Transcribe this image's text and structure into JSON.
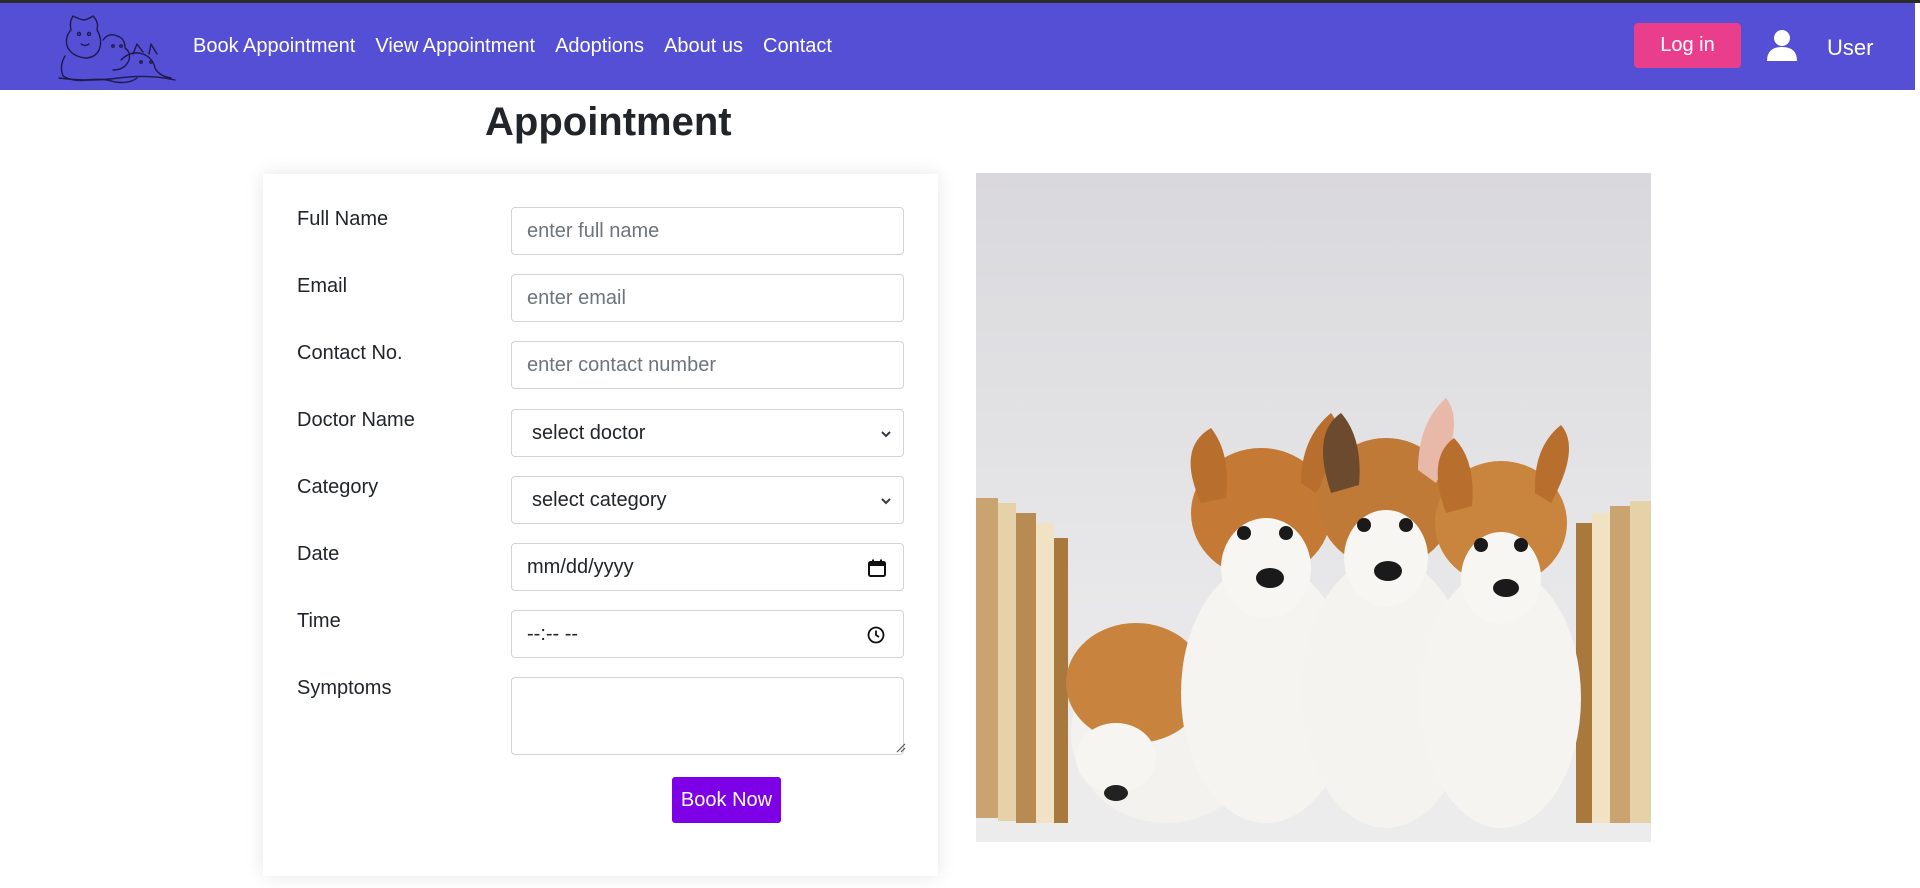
{
  "nav": {
    "links": [
      "Book Appointment",
      "View Appointment",
      "Adoptions",
      "About us",
      "Contact"
    ],
    "login_label": "Log in",
    "user_label": "User",
    "logo_icon": "pets-logo-icon",
    "user_icon": "user-icon"
  },
  "page": {
    "title": "Appointment"
  },
  "form": {
    "full_name": {
      "label": "Full Name",
      "placeholder": "enter full name"
    },
    "email": {
      "label": "Email",
      "placeholder": "enter email"
    },
    "contact": {
      "label": "Contact No.",
      "placeholder": "enter contact number"
    },
    "doctor": {
      "label": "Doctor Name",
      "selected": "select doctor"
    },
    "category": {
      "label": "Category",
      "selected": "select category"
    },
    "date": {
      "label": "Date",
      "value": "mm/dd/yyyy"
    },
    "time": {
      "label": "Time",
      "value": "--:-- --"
    },
    "symptoms": {
      "label": "Symptoms",
      "value": ""
    },
    "submit_label": "Book Now"
  },
  "colors": {
    "navbar": "#544fd4",
    "login_button": "#e83e8c",
    "book_button": "#7d00e7"
  }
}
